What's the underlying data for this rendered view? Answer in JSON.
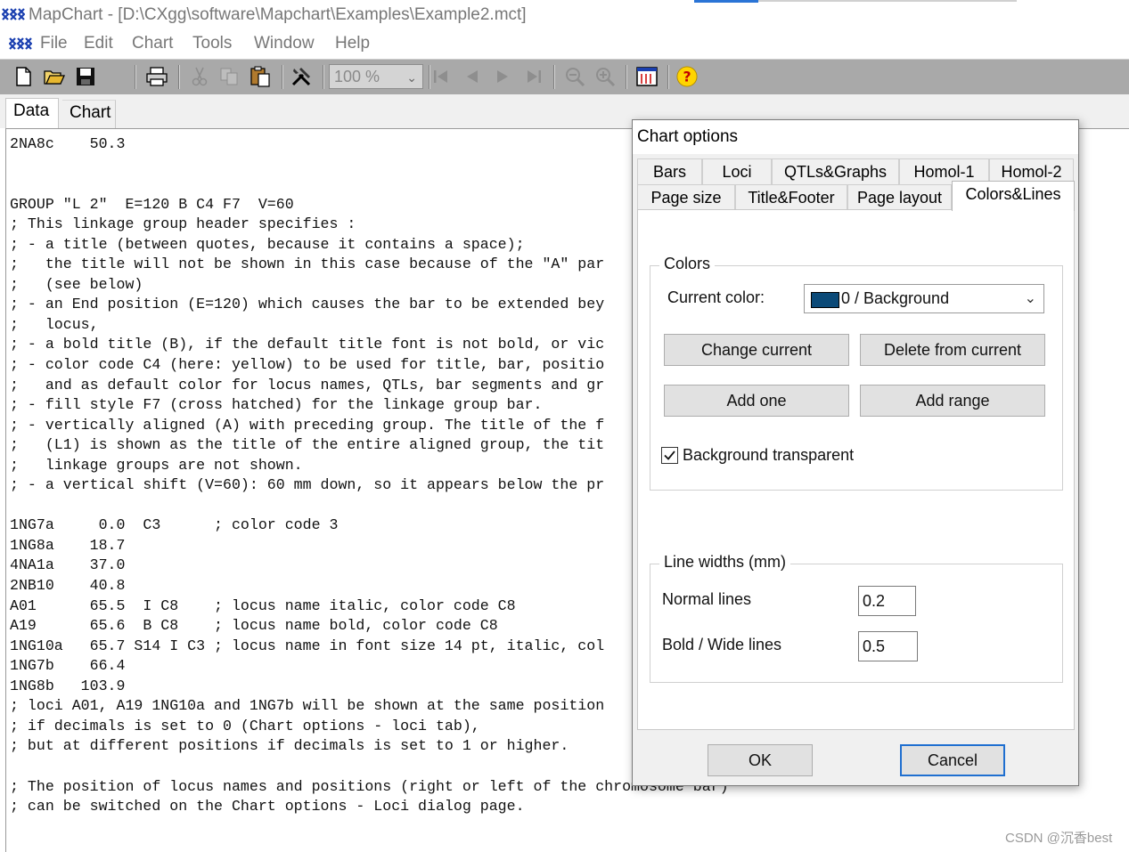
{
  "window": {
    "title": "MapChart - [D:\\CXgg\\software\\Mapchart\\Examples\\Example2.mct]"
  },
  "menu": [
    "File",
    "Edit",
    "Chart",
    "Tools",
    "Window",
    "Help"
  ],
  "toolbar": {
    "zoom_value": "100 %",
    "icons": [
      "new-file-icon",
      "open-folder-icon",
      "save-icon",
      "print-icon",
      "cut-icon",
      "copy-icon",
      "paste-icon",
      "tools-icon",
      "first-page-icon",
      "prev-page-icon",
      "next-page-icon",
      "last-page-icon",
      "zoom-out-icon",
      "zoom-in-icon",
      "chart-options-icon",
      "help-icon"
    ]
  },
  "doc_tabs": [
    {
      "label": "Data",
      "active": true
    },
    {
      "label": "Chart",
      "active": false
    }
  ],
  "editor": {
    "lines": [
      "2NA8c    50.3",
      "",
      "",
      "GROUP \"L 2\"  E=120 B C4 F7  V=60",
      "; This linkage group header specifies :",
      "; - a title (between quotes, because it contains a space);",
      ";   the title will not be shown in this case because of the \"A\" par",
      ";   (see below)",
      "; - an End position (E=120) which causes the bar to be extended bey",
      ";   locus,",
      "; - a bold title (B), if the default title font is not bold, or vic",
      "; - color code C4 (here: yellow) to be used for title, bar, positio",
      ";   and as default color for locus names, QTLs, bar segments and gr",
      "; - fill style F7 (cross hatched) for the linkage group bar.",
      "; - vertically aligned (A) with preceding group. The title of the f",
      ";   (L1) is shown as the title of the entire aligned group, the tit",
      ";   linkage groups are not shown.",
      "; - a vertical shift (V=60): 60 mm down, so it appears below the pr",
      "",
      "1NG7a     0.0  C3      ; color code 3",
      "1NG8a    18.7",
      "4NA1a    37.0",
      "2NB10    40.8",
      "A01      65.5  I C8    ; locus name italic, color code C8",
      "A19      65.6  B C8    ; locus name bold, color code C8",
      "1NG10a   65.7 S14 I C3 ; locus name in font size 14 pt, italic, col",
      "1NG7b    66.4",
      "1NG8b   103.9",
      "; loci A01, A19 1NG10a and 1NG7b will be shown at the same position",
      "; if decimals is set to 0 (Chart options - loci tab),",
      "; but at different positions if decimals is set to 1 or higher.",
      "",
      "; The position of locus names and positions (right or left of the chromosome bar)",
      "; can be switched on the Chart options - Loci dialog page."
    ]
  },
  "dialog": {
    "title": "Chart options",
    "tabs_row1": [
      "Bars",
      "Loci",
      "QTLs&Graphs",
      "Homol-1",
      "Homol-2"
    ],
    "tabs_row2": [
      "Page size",
      "Title&Footer",
      "Page layout",
      "Colors&Lines"
    ],
    "active_tab": "Colors&Lines",
    "colors_group": {
      "title": "Colors",
      "current_color_label": "Current color:",
      "current_color_value": "0 / Background",
      "current_color_swatch": "#0b4a78",
      "change_current": "Change current",
      "delete_from_current": "Delete from current",
      "add_one": "Add one",
      "add_range": "Add range",
      "background_transparent_label": "Background transparent",
      "background_transparent_checked": true
    },
    "line_widths_group": {
      "title": "Line widths (mm)",
      "normal_lines_label": "Normal lines",
      "normal_lines_value": "0.2",
      "bold_lines_label": "Bold / Wide lines",
      "bold_lines_value": "0.5"
    },
    "ok_label": "OK",
    "cancel_label": "Cancel"
  },
  "watermark": "CSDN @沉香best",
  "colors": {
    "toolbar_bg": "#a9a9a9",
    "dialog_bg": "#f0f0f0",
    "focus_border": "#1f6fd0"
  }
}
